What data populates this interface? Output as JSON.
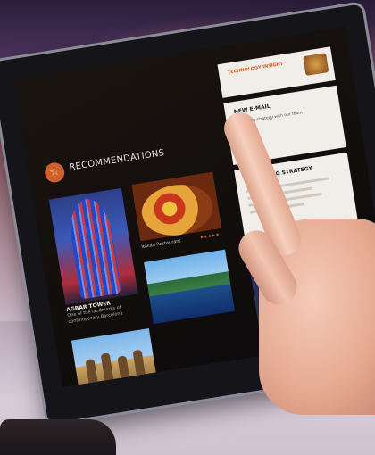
{
  "screen": {
    "recommendations": {
      "title": "RECOMMENDATIONS",
      "badge_icon": "star-icon"
    },
    "tiles": {
      "tower": {
        "title": "AGBAR TOWER",
        "subtitle": "One of the landmarks of contemporary Barcelona"
      },
      "pizza": {
        "caption": "Italian Restaurant",
        "rating_text": "★★★★★"
      }
    },
    "cards": {
      "tech": {
        "title": "TECHNOLOGY INSIGHT"
      },
      "email": {
        "title": "NEW E-MAIL",
        "body": "Marketing strategy with our team"
      },
      "marketing": {
        "title": "MARKETING STRATEGY"
      }
    }
  },
  "colors": {
    "accent": "#d0602a",
    "card_bg": "#f1eee9"
  }
}
